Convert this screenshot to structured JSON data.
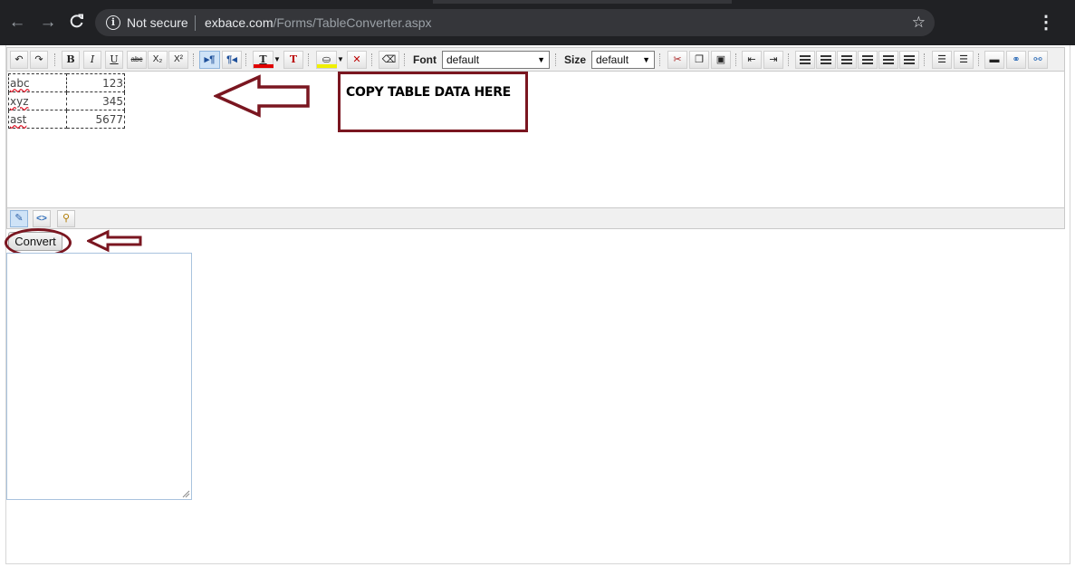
{
  "browser": {
    "nav": {
      "back_icon": "←",
      "forward_icon": "→",
      "reload_icon": "C"
    },
    "security_label": "Not secure",
    "url_domain": "exbace.com",
    "url_path": "/Forms/TableConverter.aspx",
    "star_icon": "☆",
    "menu_icon": "⋮"
  },
  "toolbar": {
    "undo": "↶",
    "redo": "↷",
    "bold": "B",
    "italic": "I",
    "underline": "U",
    "strike": "abc",
    "subscript": "X₂",
    "superscript": "X²",
    "ltr": "¶",
    "rtl": "¶",
    "text_color": "T",
    "clear_color": "T",
    "font_label": "Font",
    "font_value": "default",
    "size_label": "Size",
    "size_value": "default"
  },
  "table_rows": [
    {
      "label": "abc",
      "value": "123"
    },
    {
      "label": "xyz",
      "value": "345"
    },
    {
      "label": "ast",
      "value": "5677"
    }
  ],
  "callout": {
    "text": "COPY TABLE DATA HERE"
  },
  "convert_button": {
    "label": "Convert"
  },
  "colors": {
    "annotation": "#7a1620",
    "text_color_swatch": "#e00000",
    "highlight_swatch": "#f0f000",
    "chrome_bg": "#202124"
  }
}
